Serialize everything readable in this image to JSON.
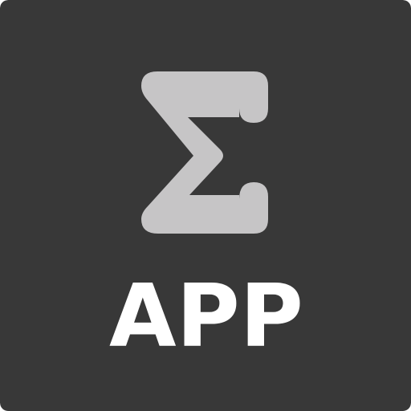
{
  "icon": {
    "symbol": "sigma-icon",
    "label": "APP",
    "colors": {
      "background": "#383838",
      "symbol": "#c6c5c6",
      "label": "#ffffff"
    }
  }
}
